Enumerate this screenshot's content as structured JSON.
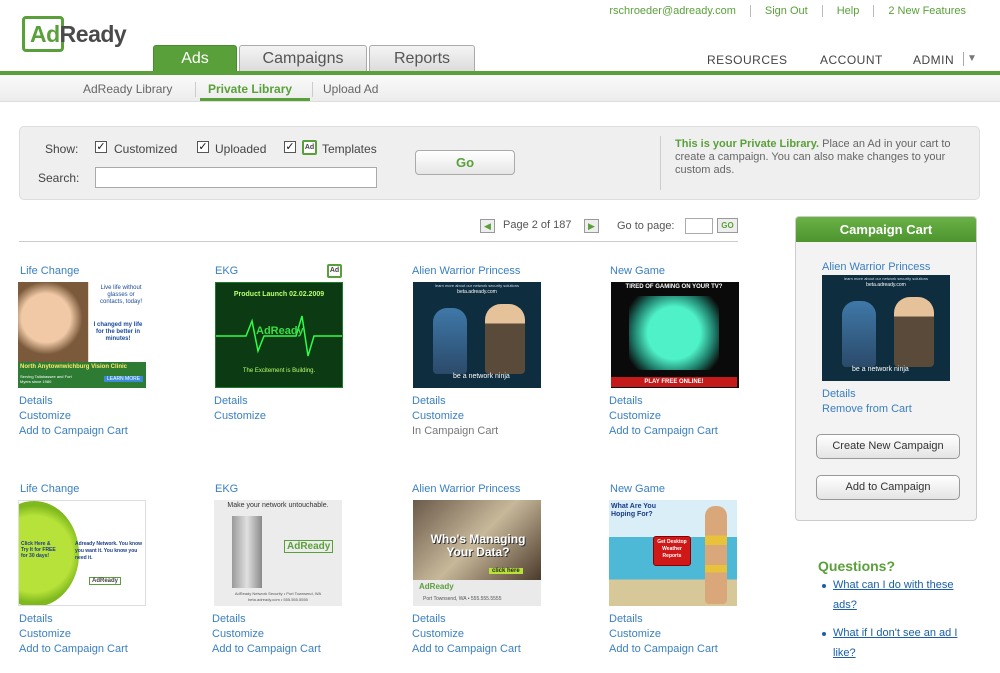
{
  "brand": {
    "logo_text_a": "Ad",
    "logo_text_b": "Ready"
  },
  "toplinks": [
    "rschroeder@adready.com",
    "Sign Out",
    "Help",
    "2 New Features"
  ],
  "tabs": {
    "ads": "Ads",
    "campaigns": "Campaigns",
    "reports": "Reports"
  },
  "right_menu": {
    "resources": "RESOURCES",
    "account": "ACCOUNT",
    "admin": "ADMIN"
  },
  "subnav": {
    "adready_library": "AdReady Library",
    "private_library": "Private Library",
    "upload_ad": "Upload Ad"
  },
  "filters": {
    "show_label": "Show:",
    "customized": "Customized",
    "uploaded": "Uploaded",
    "templates": "Templates",
    "search_label": "Search:",
    "search_value": "",
    "go": "Go"
  },
  "info": {
    "highlight": "This is your Private Library.",
    "text": " Place an Ad in your cart to create a campaign. You can also make changes to your custom ads."
  },
  "pagination": {
    "page_text": "Page 2 of 187",
    "goto_label": "Go to page:",
    "goto_btn": "GO"
  },
  "ads": [
    {
      "title": "Life Change",
      "a1": "Details",
      "a2": "Customize",
      "a3": "Add to Campaign Cart",
      "lines": [
        "Live life without glasses or contacts, today!",
        "I changed my life for the better in minutes!",
        "North Anytownwichburg Vision Clinic",
        "Serving Tallahassee and Fort Myers since 1980",
        "LEARN MORE"
      ]
    },
    {
      "title": "EKG",
      "a1": "Details",
      "a2": "Customize",
      "a3": "",
      "lines": [
        "Product Launch 02.02.2009",
        "AdReady",
        "The Excitement is Building."
      ]
    },
    {
      "title": "Alien Warrior Princess",
      "a1": "Details",
      "a2": "Customize",
      "a3": "In Campaign Cart",
      "lines": [
        "learn more about our network security solutions",
        "beta.adready.com",
        "be a network ninja"
      ]
    },
    {
      "title": "New Game",
      "a1": "Details",
      "a2": "Customize",
      "a3": "Add to Campaign Cart",
      "lines": [
        "TIRED OF GAMING ON YOUR TV?",
        "PLAY FREE ONLINE!"
      ]
    },
    {
      "title": "Life Change",
      "a1": "Details",
      "a2": "Customize",
      "a3": "Add to Campaign Cart",
      "lines": [
        "Click Here & Try It for FREE for 30 days!",
        "Adready Network. You know you want it. You know you need it.",
        "AdReady"
      ]
    },
    {
      "title": "EKG",
      "a1": "Details",
      "a2": "Customize",
      "a3": "Add to Campaign Cart",
      "lines": [
        "Make your network untouchable.",
        "AdReady",
        "AdReady Network Security • Port Townsend, WA",
        "beta.adready.com • 555.555.5555"
      ]
    },
    {
      "title": "Alien Warrior Princess",
      "a1": "Details",
      "a2": "Customize",
      "a3": "Add to Campaign Cart",
      "lines": [
        "Who's Managing Your Data?",
        "click here",
        "AdReady",
        "Port Townsend, WA • 555.555.5555"
      ]
    },
    {
      "title": "New Game",
      "a1": "Details",
      "a2": "Customize",
      "a3": "Add to Campaign Cart",
      "lines": [
        "What Are You Hoping For?",
        "Get Desktop Weather Reports"
      ]
    }
  ],
  "cart": {
    "title": "Campaign Cart",
    "item_title": "Alien Warrior Princess",
    "item_lines": [
      "learn more about our network security solutions",
      "beta.adready.com",
      "be a network ninja"
    ],
    "details": "Details",
    "remove": "Remove from Cart",
    "create": "Create New Campaign",
    "add": "Add to Campaign"
  },
  "questions": {
    "title": "Questions?",
    "q1": "What can I do with these ads?",
    "q2": "What if I don't see an ad I like?"
  },
  "colors": {
    "brand_green": "#5aa03a",
    "link_blue": "#3a7fc1"
  }
}
